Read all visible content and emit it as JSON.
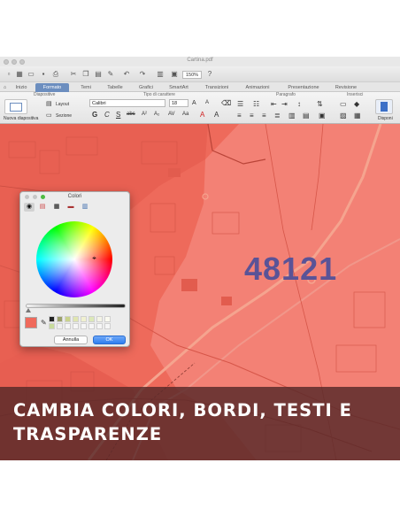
{
  "window": {
    "doc_title": "Cartina.pdf"
  },
  "toolbar": {
    "zoom": "150%"
  },
  "ribbon_tabs": [
    {
      "label": "Inizio",
      "active": false
    },
    {
      "label": "Formato",
      "active": true
    },
    {
      "label": "Temi",
      "active": false
    },
    {
      "label": "Tabelle",
      "active": false
    },
    {
      "label": "Grafici",
      "active": false
    },
    {
      "label": "SmartArt",
      "active": false
    },
    {
      "label": "Transizioni",
      "active": false
    },
    {
      "label": "Animazioni",
      "active": false
    },
    {
      "label": "Presentazione",
      "active": false
    },
    {
      "label": "Revisione",
      "active": false
    }
  ],
  "ribbon": {
    "groups": {
      "diapositive": "Diapositive",
      "tipo_carattere": "Tipo di carattere",
      "paragrafo": "Paragrafo",
      "inserisci": "Inserisci"
    },
    "new_slide": "Nuova diapositiva",
    "layout": "Layout",
    "sezione": "Sezione",
    "font_name": "Calibri",
    "font_size": "18",
    "disponi": "Disponi"
  },
  "map": {
    "postcode": "48121",
    "fill_color": "#ef6a5c",
    "text_color": "#5a5397"
  },
  "colors_dialog": {
    "title": "Colori",
    "tools": [
      "color-wheel-icon",
      "color-sliders-icon",
      "color-palettes-icon",
      "image-palettes-icon",
      "crayons-icon"
    ],
    "selected_color": "#ef6a5c",
    "cancel_label": "Annulla",
    "ok_label": "OK"
  },
  "banner": {
    "text": "CAMBIA COLORI, BORDI, TESTI E TRASPARENZE"
  }
}
